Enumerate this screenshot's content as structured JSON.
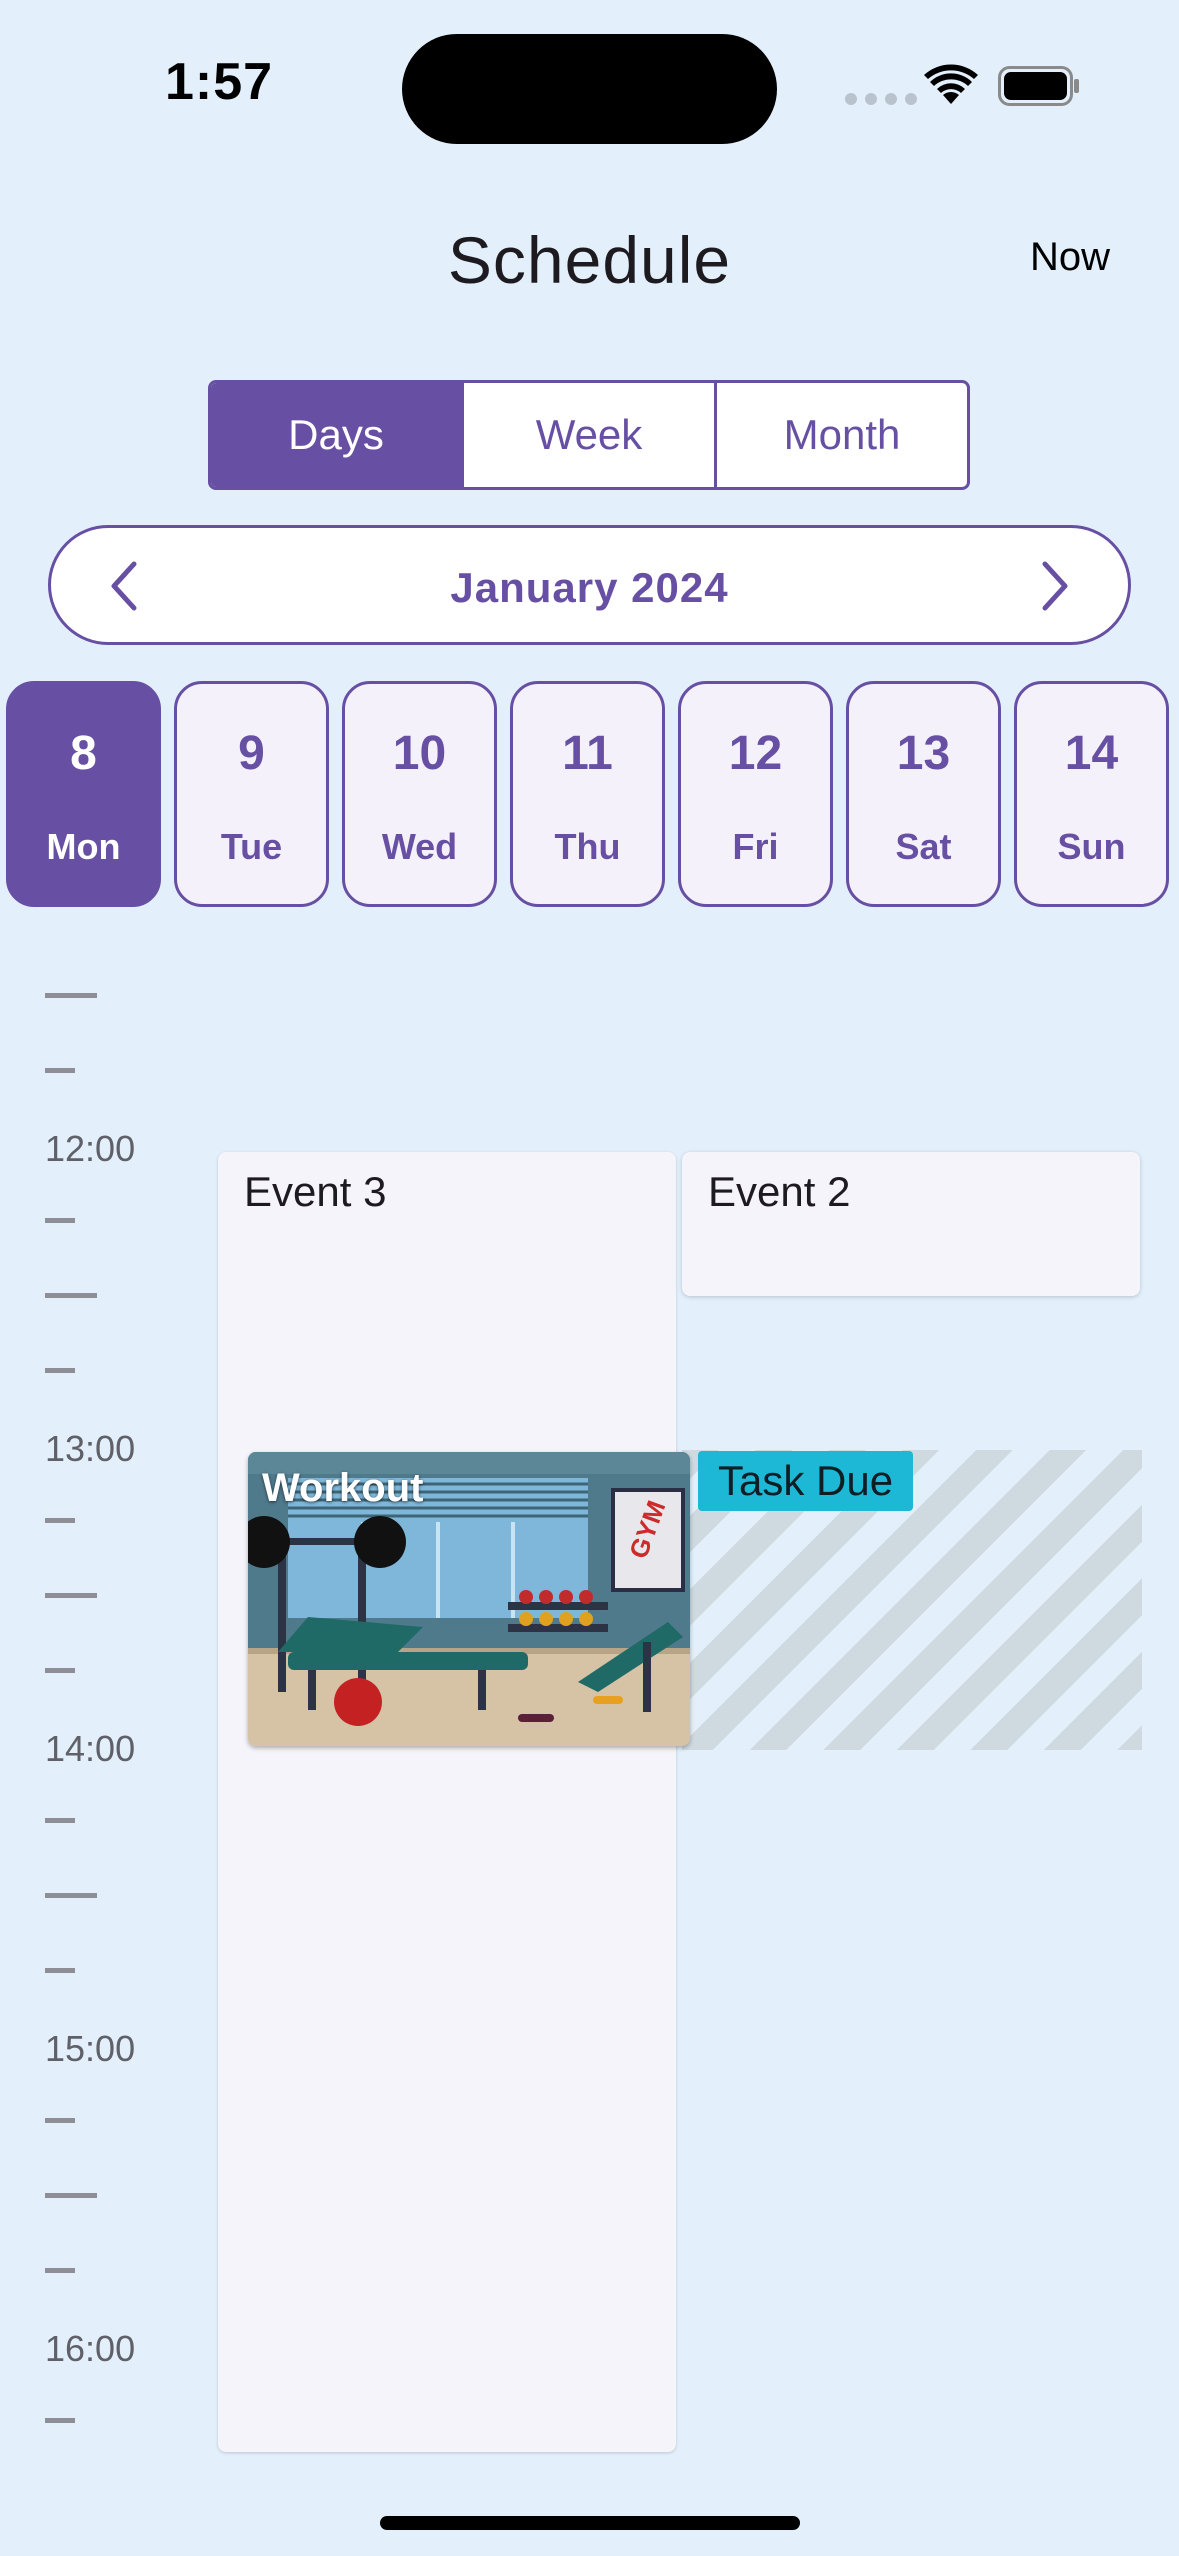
{
  "status_bar": {
    "time": "1:57"
  },
  "header": {
    "title": "Schedule",
    "now_label": "Now"
  },
  "view_segments": [
    {
      "label": "Days",
      "active": true
    },
    {
      "label": "Week",
      "active": false
    },
    {
      "label": "Month",
      "active": false
    }
  ],
  "month_nav": {
    "label": "January 2024"
  },
  "days": [
    {
      "num": "8",
      "name": "Mon",
      "active": true
    },
    {
      "num": "9",
      "name": "Tue",
      "active": false
    },
    {
      "num": "10",
      "name": "Wed",
      "active": false
    },
    {
      "num": "11",
      "name": "Thu",
      "active": false
    },
    {
      "num": "12",
      "name": "Fri",
      "active": false
    },
    {
      "num": "13",
      "name": "Sat",
      "active": false
    },
    {
      "num": "14",
      "name": "Sun",
      "active": false
    }
  ],
  "timeline": {
    "hours": [
      "12:00",
      "13:00",
      "14:00",
      "15:00",
      "16:00"
    ]
  },
  "events": {
    "event_3": "Event 3",
    "event_2": "Event 2",
    "workout": "Workout",
    "task": "Task Due"
  },
  "colors": {
    "accent": "#6750a4",
    "background": "#e3f0fc",
    "task_badge": "#1cb8d6"
  }
}
